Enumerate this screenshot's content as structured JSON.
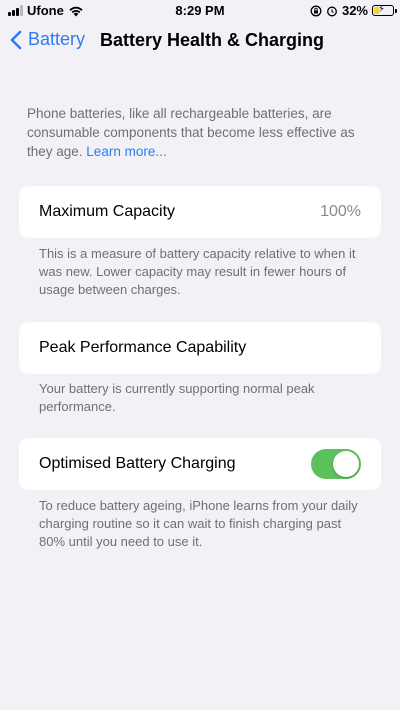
{
  "status_bar": {
    "carrier": "Ufone",
    "time": "8:29 PM",
    "battery_percent": "32%",
    "battery_level": 0.32,
    "icons": [
      "signal-icon",
      "wifi-icon",
      "screen-lock-icon",
      "alarm-icon",
      "battery-charging-icon"
    ]
  },
  "nav": {
    "back_label": "Battery",
    "title": "Battery Health & Charging"
  },
  "intro": {
    "text": "Phone batteries, like all rechargeable batteries, are consumable components that become less effective as they age. ",
    "link": "Learn more..."
  },
  "maximum_capacity": {
    "label": "Maximum Capacity",
    "value": "100%",
    "caption": "This is a measure of battery capacity relative to when it was new. Lower capacity may result in fewer hours of usage between charges."
  },
  "peak_performance": {
    "label": "Peak Performance Capability",
    "caption": "Your battery is currently supporting normal peak performance."
  },
  "optimised_charging": {
    "label": "Optimised Battery Charging",
    "enabled": true,
    "caption": "To reduce battery ageing, iPhone learns from your daily charging routine so it can wait to finish charging past 80% until you need to use it."
  },
  "colors": {
    "accent": "#2b7cf6",
    "toggle_on": "#5cc15c",
    "background": "#f2f1f6",
    "battery_fill": "#f6d23a"
  }
}
